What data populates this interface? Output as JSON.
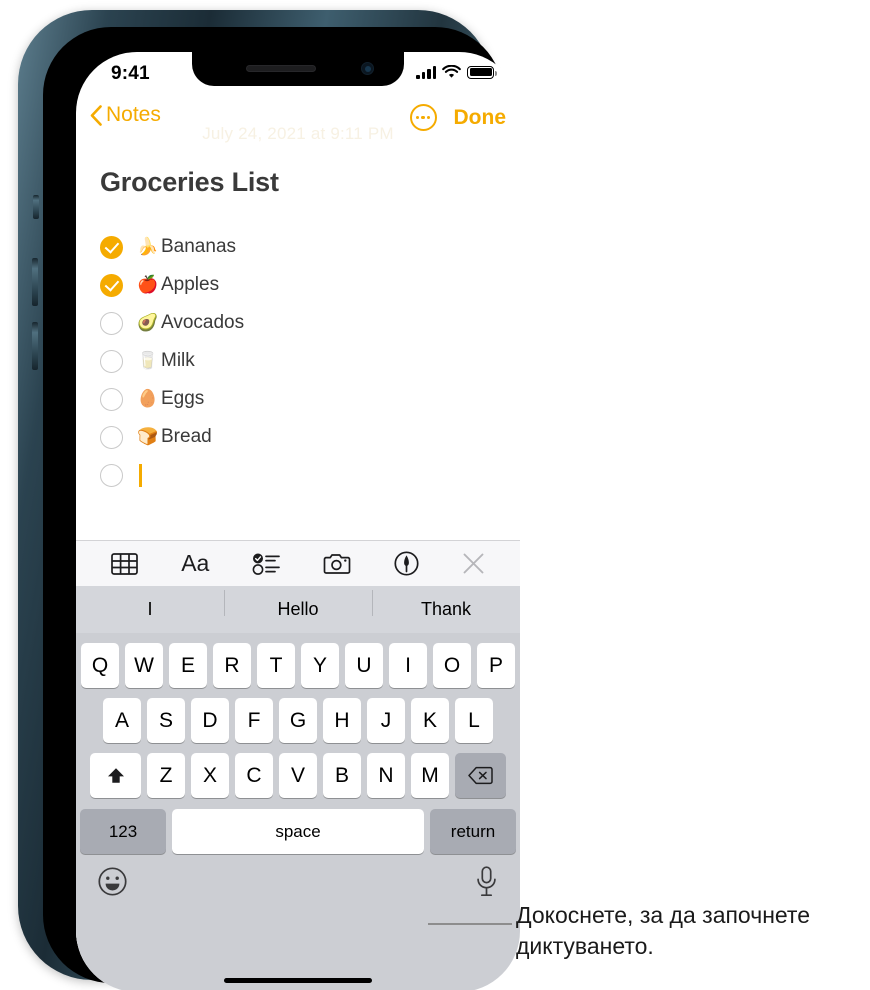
{
  "status_bar": {
    "time": "9:41",
    "signal_icon": "cellular-bars-icon",
    "wifi_icon": "wifi-icon",
    "battery_icon": "battery-icon"
  },
  "nav_bar": {
    "back_label": "Notes",
    "back_chevron_icon": "chevron-left-icon",
    "more_icon": "more-ellipsis-icon",
    "done_label": "Done"
  },
  "note": {
    "date": "July 24, 2021 at 9:11 PM",
    "title": "Groceries List",
    "items": [
      {
        "emoji": "🍌",
        "label": "Bananas",
        "checked": true
      },
      {
        "emoji": "🍎",
        "label": "Apples",
        "checked": true
      },
      {
        "emoji": "🥑",
        "label": "Avocados",
        "checked": false
      },
      {
        "emoji": "🥛",
        "label": "Milk",
        "checked": false
      },
      {
        "emoji": "🥚",
        "label": "Eggs",
        "checked": false
      },
      {
        "emoji": "🍞",
        "label": "Bread",
        "checked": false
      },
      {
        "emoji": "",
        "label": "",
        "checked": false
      }
    ]
  },
  "format_toolbar": {
    "items": [
      {
        "name": "table-icon",
        "label": "Table"
      },
      {
        "name": "format-aa-icon",
        "label": "Aa"
      },
      {
        "name": "checklist-icon",
        "label": "Checklist"
      },
      {
        "name": "camera-icon",
        "label": "Camera"
      },
      {
        "name": "markup-pen-icon",
        "label": "Markup"
      },
      {
        "name": "close-icon",
        "label": "Close"
      }
    ]
  },
  "keyboard": {
    "predictions": [
      "I",
      "Hello",
      "Thank"
    ],
    "row1": [
      "Q",
      "W",
      "E",
      "R",
      "T",
      "Y",
      "U",
      "I",
      "O",
      "P"
    ],
    "row2": [
      "A",
      "S",
      "D",
      "F",
      "G",
      "H",
      "J",
      "K",
      "L"
    ],
    "row3": [
      "Z",
      "X",
      "C",
      "V",
      "B",
      "N",
      "M"
    ],
    "shift_icon": "shift-arrow-icon",
    "backspace_icon": "backspace-icon",
    "numbers_label": "123",
    "space_label": "space",
    "return_label": "return",
    "emoji_icon": "emoji-smiley-icon",
    "dictation_icon": "microphone-icon"
  },
  "callout": {
    "text": "Докоснете, за да започнете диктуването."
  },
  "colors": {
    "accent": "#F5AB00",
    "keyboard_bg": "#CCCED3",
    "text": "#3A3A3A"
  }
}
